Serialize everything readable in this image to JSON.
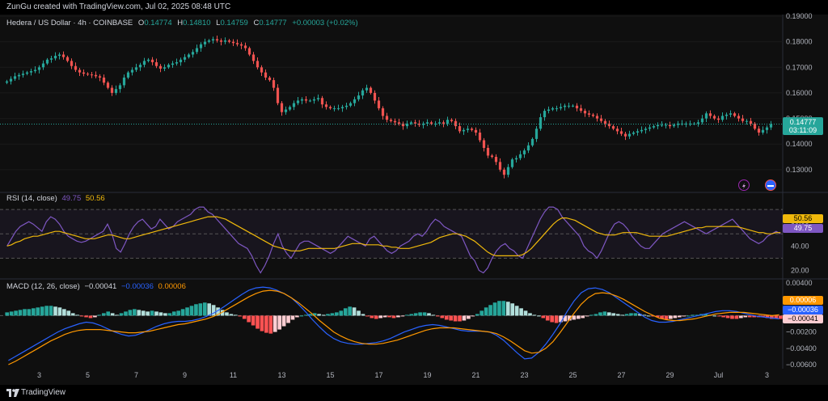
{
  "header": {
    "created": "ZunGu created with TradingView.com, Jul 02, 2025 08:48 UTC"
  },
  "symbol": {
    "title": "Hedera / US Dollar · 4h · COINBASE",
    "o_label": "O",
    "o": "0.14774",
    "h_label": "H",
    "h": "0.14810",
    "l_label": "L",
    "l": "0.14759",
    "c_label": "C",
    "c": "0.14777",
    "change": "+0.00003 (+0.02%)",
    "last_price": "0.14777",
    "countdown": "03:11:09"
  },
  "rsi": {
    "label": "RSI (14, close)",
    "v1": "49.75",
    "v2": "50.56"
  },
  "macd": {
    "label": "MACD (12, 26, close)",
    "hist": "−0.00041",
    "macd": "−0.00036",
    "signal": "0.00006"
  },
  "footer": {
    "brand": "TradingView"
  },
  "colors": {
    "up": "#26a69a",
    "down": "#ef5350",
    "rsi": "#7e57c2",
    "rsima": "#f0b90b",
    "macd": "#2962ff",
    "signal": "#ff9800"
  },
  "chart_data": [
    {
      "type": "candlestick",
      "title": "Hedera / US Dollar · 4h · COINBASE",
      "xlabel": "",
      "ylabel": "",
      "ylim": [
        0.123,
        0.19
      ],
      "y_ticks": [
        0.13,
        0.14,
        0.15,
        0.16,
        0.17,
        0.18,
        0.19
      ],
      "y_tick_labels": [
        "0.13000",
        "0.14000",
        "0.15000",
        "0.16000",
        "0.17000",
        "0.18000",
        "0.19000"
      ],
      "x_tick_labels": [
        "3",
        "5",
        "7",
        "9",
        "11",
        "13",
        "15",
        "17",
        "19",
        "21",
        "23",
        "25",
        "27",
        "29",
        "Jul",
        "3"
      ],
      "x_ticks_bars": [
        8,
        20,
        32,
        44,
        56,
        68,
        80,
        92,
        104,
        116,
        128,
        140,
        152,
        164,
        176,
        188
      ],
      "close_series": [
        0.1645,
        0.1655,
        0.1665,
        0.167,
        0.1675,
        0.168,
        0.1685,
        0.169,
        0.17,
        0.1715,
        0.173,
        0.1735,
        0.1745,
        0.175,
        0.174,
        0.1725,
        0.1705,
        0.169,
        0.168,
        0.1675,
        0.1672,
        0.167,
        0.1665,
        0.166,
        0.164,
        0.162,
        0.16,
        0.1615,
        0.163,
        0.166,
        0.168,
        0.169,
        0.17,
        0.171,
        0.1725,
        0.173,
        0.172,
        0.1705,
        0.1695,
        0.17,
        0.171,
        0.1715,
        0.172,
        0.173,
        0.174,
        0.175,
        0.176,
        0.1775,
        0.179,
        0.18,
        0.1805,
        0.181,
        0.1805,
        0.18,
        0.1805,
        0.18,
        0.1795,
        0.179,
        0.1785,
        0.1775,
        0.175,
        0.1725,
        0.17,
        0.168,
        0.166,
        0.165,
        0.162,
        0.156,
        0.1525,
        0.1535,
        0.1545,
        0.156,
        0.157,
        0.1575,
        0.157,
        0.157,
        0.1575,
        0.158,
        0.1555,
        0.1545,
        0.154,
        0.154,
        0.154,
        0.1545,
        0.155,
        0.156,
        0.1575,
        0.159,
        0.161,
        0.162,
        0.16,
        0.157,
        0.154,
        0.151,
        0.1495,
        0.149,
        0.1485,
        0.148,
        0.147,
        0.148,
        0.1485,
        0.148,
        0.1475,
        0.148,
        0.1485,
        0.148,
        0.148,
        0.1485,
        0.148,
        0.1495,
        0.149,
        0.147,
        0.145,
        0.1455,
        0.146,
        0.1455,
        0.1445,
        0.1415,
        0.1385,
        0.1355,
        0.135,
        0.133,
        0.13,
        0.128,
        0.131,
        0.134,
        0.1345,
        0.136,
        0.1375,
        0.1395,
        0.142,
        0.146,
        0.1505,
        0.153,
        0.1535,
        0.154,
        0.154,
        0.1545,
        0.155,
        0.155,
        0.155,
        0.154,
        0.153,
        0.152,
        0.1515,
        0.151,
        0.15,
        0.149,
        0.148,
        0.147,
        0.146,
        0.145,
        0.144,
        0.143,
        0.144,
        0.1445,
        0.145,
        0.1455,
        0.146,
        0.1465,
        0.147,
        0.1475,
        0.1475,
        0.1475,
        0.147,
        0.1475,
        0.148,
        0.148,
        0.148,
        0.148,
        0.148,
        0.1485,
        0.15,
        0.152,
        0.151,
        0.15,
        0.1495,
        0.151,
        0.1515,
        0.152,
        0.151,
        0.15,
        0.149,
        0.149,
        0.148,
        0.146,
        0.1445,
        0.1455,
        0.1465,
        0.1478
      ]
    },
    {
      "type": "line",
      "title": "RSI (14, close)",
      "ylim": [
        15,
        80
      ],
      "y_ticks": [
        20,
        40,
        60
      ],
      "bands": [
        30,
        70
      ],
      "series": [
        {
          "name": "RSI",
          "values": [
            40,
            46,
            52,
            56,
            58,
            60,
            58,
            55,
            52,
            60,
            64,
            62,
            58,
            52,
            48,
            46,
            44,
            43,
            44,
            46,
            48,
            50,
            52,
            58,
            50,
            38,
            35,
            42,
            50,
            56,
            60,
            62,
            58,
            54,
            56,
            62,
            58,
            54,
            56,
            60,
            62,
            64,
            66,
            70,
            72,
            72,
            68,
            66,
            62,
            58,
            54,
            50,
            46,
            42,
            40,
            38,
            32,
            24,
            18,
            24,
            32,
            42,
            50,
            40,
            34,
            30,
            36,
            42,
            44,
            44,
            42,
            40,
            38,
            36,
            34,
            36,
            40,
            44,
            48,
            46,
            44,
            42,
            40,
            46,
            48,
            44,
            40,
            36,
            34,
            36,
            40,
            42,
            44,
            48,
            50,
            48,
            52,
            58,
            62,
            60,
            56,
            54,
            52,
            50,
            48,
            40,
            32,
            28,
            20,
            18,
            22,
            30,
            36,
            40,
            42,
            38,
            36,
            32,
            30,
            38,
            46,
            54,
            62,
            68,
            72,
            72,
            70,
            64,
            60,
            56,
            52,
            48,
            40,
            36,
            34,
            30,
            36,
            44,
            52,
            58,
            60,
            58,
            54,
            48,
            44,
            40,
            38,
            38,
            42,
            46,
            50,
            52,
            54,
            56,
            58,
            60,
            58,
            56,
            54,
            52,
            50,
            52,
            54,
            56,
            58,
            60,
            62,
            58,
            54,
            50,
            46,
            44,
            42,
            44,
            48,
            50,
            52,
            50
          ]
        },
        {
          "name": "RSI-based MA",
          "values": [
            40,
            41,
            43,
            44,
            46,
            47,
            48,
            48,
            49,
            50,
            51,
            52,
            52,
            51,
            50,
            49,
            48,
            47,
            46,
            46,
            46,
            47,
            48,
            49,
            49,
            48,
            47,
            46,
            46,
            47,
            48,
            49,
            50,
            51,
            52,
            53,
            54,
            55,
            56,
            57,
            58,
            59,
            60,
            61,
            62,
            63,
            64,
            64,
            64,
            63,
            62,
            60,
            58,
            56,
            54,
            52,
            50,
            48,
            46,
            44,
            42,
            40,
            39,
            38,
            37,
            36,
            36,
            36,
            37,
            38,
            38,
            38,
            38,
            38,
            38,
            38,
            39,
            40,
            41,
            42,
            42,
            42,
            41,
            41,
            41,
            41,
            40,
            40,
            39,
            39,
            38,
            38,
            38,
            39,
            40,
            41,
            42,
            43,
            45,
            47,
            48,
            49,
            50,
            50,
            49,
            48,
            46,
            44,
            41,
            38,
            35,
            33,
            32,
            32,
            32,
            32,
            32,
            32,
            33,
            35,
            38,
            42,
            46,
            50,
            54,
            58,
            61,
            63,
            63,
            62,
            61,
            59,
            57,
            55,
            53,
            51,
            50,
            49,
            49,
            49,
            50,
            51,
            51,
            51,
            51,
            50,
            49,
            48,
            48,
            48,
            48,
            48,
            49,
            50,
            51,
            52,
            53,
            54,
            55,
            55,
            56,
            56,
            56,
            56,
            56,
            56,
            56,
            56,
            55,
            54,
            53,
            52,
            51,
            51,
            50,
            50,
            51,
            51
          ]
        }
      ]
    },
    {
      "type": "bar+line",
      "title": "MACD (12, 26, close)",
      "ylim": [
        -0.0063,
        0.0042
      ],
      "y_ticks": [
        0.004,
        0.002,
        0,
        -0.002,
        -0.004,
        -0.006
      ],
      "y_tick_labels": [
        "0.00400",
        "0.00200",
        "0.00000",
        "−0.00200",
        "−0.00400",
        "−0.00600"
      ],
      "histogram": [
        0.0004,
        0.0005,
        0.0006,
        0.0007,
        0.0008,
        0.0008,
        0.0009,
        0.001,
        0.0011,
        0.0012,
        0.0012,
        0.0011,
        0.001,
        0.0008,
        0.0006,
        0.0003,
        0.0001,
        -0.0001,
        -0.0002,
        -0.0003,
        -0.0002,
        0.0001,
        0.0003,
        0.0005,
        0.0003,
        0.0001,
        0.0003,
        0.0005,
        0.0007,
        0.0008,
        0.0007,
        0.0006,
        0.0005,
        0.0006,
        0.0005,
        0.0004,
        0.0003,
        0.0003,
        0.0005,
        0.0006,
        0.0008,
        0.001,
        0.0012,
        0.0014,
        0.0015,
        0.0016,
        0.0015,
        0.0013,
        0.001,
        0.0007,
        0.0004,
        0.0002,
        0.0001,
        -0.0001,
        -0.0004,
        -0.0008,
        -0.0012,
        -0.0016,
        -0.0019,
        -0.0021,
        -0.0022,
        -0.002,
        -0.0017,
        -0.0013,
        -0.0009,
        -0.0005,
        -0.0002,
        0,
        0.0001,
        0.0002,
        0.0003,
        0.0002,
        0.0001,
        0.0002,
        0.0003,
        0.0004,
        0.0006,
        0.0009,
        0.0011,
        0.001,
        0.0006,
        0.0002,
        -0.0001,
        -0.0003,
        -0.0004,
        -0.0003,
        -0.0002,
        -0.0002,
        -0.0003,
        -0.0002,
        -0.0001,
        0.0001,
        0.0002,
        0.0003,
        0.0004,
        0.0004,
        0.0003,
        0.0001,
        -0.0001,
        -0.0003,
        -0.0005,
        -0.0006,
        -0.0007,
        -0.0007,
        -0.0006,
        -0.0004,
        -0.0001,
        0.0002,
        0.0006,
        0.001,
        0.0013,
        0.0016,
        0.0018,
        0.0018,
        0.0017,
        0.0015,
        0.0012,
        0.0009,
        0.0006,
        0.0003,
        0.0001,
        0,
        -0.0003,
        -0.0006,
        -0.0008,
        -0.0009,
        -0.0008,
        -0.0007,
        -0.0006,
        -0.0005,
        -0.0004,
        -0.0003,
        -0.0001,
        0.0001,
        0.0002,
        0.0004,
        0.0005,
        0.0004,
        0.0003,
        0.0002,
        0.0001,
        0.0002,
        0.0003,
        0.0003,
        0.0002,
        0.0001,
        0,
        -0.0001,
        -0.0002,
        -0.0004,
        -0.0005,
        -0.0004,
        -0.0003,
        -0.0002,
        -0.0001,
        0,
        0.0001,
        0.0001,
        0.0002,
        0.0002,
        0.0001,
        0,
        -0.0001,
        -0.0002,
        -0.0003,
        -0.0004,
        -0.0004,
        -0.0003,
        -0.0002,
        -0.0002,
        -0.0002,
        -0.0002,
        -0.0002,
        -0.0003,
        -0.0004,
        -0.0004,
        -0.0004
      ],
      "series": [
        {
          "name": "MACD",
          "values": [
            -0.0055,
            -0.005,
            -0.0045,
            -0.004,
            -0.0035,
            -0.003,
            -0.0025,
            -0.002,
            -0.0016,
            -0.0013,
            -0.001,
            -0.0008,
            -0.0009,
            -0.0012,
            -0.0016,
            -0.002,
            -0.0023,
            -0.0025,
            -0.0024,
            -0.0021,
            -0.0017,
            -0.0013,
            -0.001,
            -0.0008,
            -0.0007,
            -0.0007,
            -0.0006,
            -0.0004,
            -0.0001,
            0.0003,
            0.0008,
            0.0014,
            0.002,
            0.0026,
            0.0031,
            0.0034,
            0.0035,
            0.0034,
            0.0031,
            0.0027,
            0.0022,
            0.0014,
            0.0005,
            -0.0005,
            -0.0014,
            -0.0022,
            -0.0028,
            -0.0032,
            -0.0034,
            -0.0035,
            -0.0035,
            -0.0034,
            -0.0033,
            -0.0031,
            -0.0028,
            -0.0024,
            -0.002,
            -0.0017,
            -0.0014,
            -0.0012,
            -0.0011,
            -0.0012,
            -0.0014,
            -0.0016,
            -0.0018,
            -0.0019,
            -0.0019,
            -0.0019,
            -0.002,
            -0.0024,
            -0.003,
            -0.0038,
            -0.0046,
            -0.0053,
            -0.0052,
            -0.0045,
            -0.0035,
            -0.0023,
            -0.001,
            0.0005,
            0.0018,
            0.0028,
            0.0033,
            0.0034,
            0.0032,
            0.0028,
            0.0022,
            0.0016,
            0.001,
            0.0004,
            -0.0002,
            -0.0006,
            -0.0008,
            -0.0008,
            -0.0007,
            -0.0005,
            -0.0003,
            -0.0001,
            0.0001,
            0.0003,
            0.0005,
            0.0006,
            0.0006,
            0.0005,
            0.0003,
            0.0001,
            -0.0001,
            -0.0002,
            -0.0003,
            -0.0004
          ]
        },
        {
          "name": "Signal",
          "values": [
            -0.006,
            -0.0056,
            -0.0051,
            -0.0046,
            -0.0041,
            -0.0036,
            -0.0031,
            -0.0027,
            -0.0023,
            -0.002,
            -0.0018,
            -0.0017,
            -0.0017,
            -0.0017,
            -0.0018,
            -0.0019,
            -0.002,
            -0.0021,
            -0.0021,
            -0.002,
            -0.0019,
            -0.0017,
            -0.0015,
            -0.0013,
            -0.0011,
            -0.001,
            -0.0008,
            -0.0006,
            -0.0004,
            -0.0001,
            0.0003,
            0.0008,
            0.0013,
            0.0018,
            0.0023,
            0.0027,
            0.003,
            0.0031,
            0.003,
            0.0027,
            0.0022,
            0.0016,
            0.0009,
            0.0002,
            -0.0006,
            -0.0013,
            -0.002,
            -0.0025,
            -0.0029,
            -0.0032,
            -0.0034,
            -0.0035,
            -0.0035,
            -0.0034,
            -0.0032,
            -0.003,
            -0.0027,
            -0.0024,
            -0.0021,
            -0.0018,
            -0.0016,
            -0.0015,
            -0.0015,
            -0.0015,
            -0.0016,
            -0.0017,
            -0.0018,
            -0.0019,
            -0.002,
            -0.0022,
            -0.0026,
            -0.0031,
            -0.0037,
            -0.0043,
            -0.0046,
            -0.0045,
            -0.004,
            -0.0032,
            -0.0021,
            -0.0009,
            0.0003,
            0.0014,
            0.0022,
            0.0027,
            0.0028,
            0.0027,
            0.0024,
            0.002,
            0.0015,
            0.001,
            0.0005,
            0.0001,
            -0.0003,
            -0.0005,
            -0.0006,
            -0.0006,
            -0.0005,
            -0.0004,
            -0.0002,
            0,
            0.0002,
            0.0003,
            0.0004,
            0.0004,
            0.0004,
            0.0003,
            0.0002,
            0.0001,
            0,
            0.0001
          ]
        }
      ]
    }
  ]
}
